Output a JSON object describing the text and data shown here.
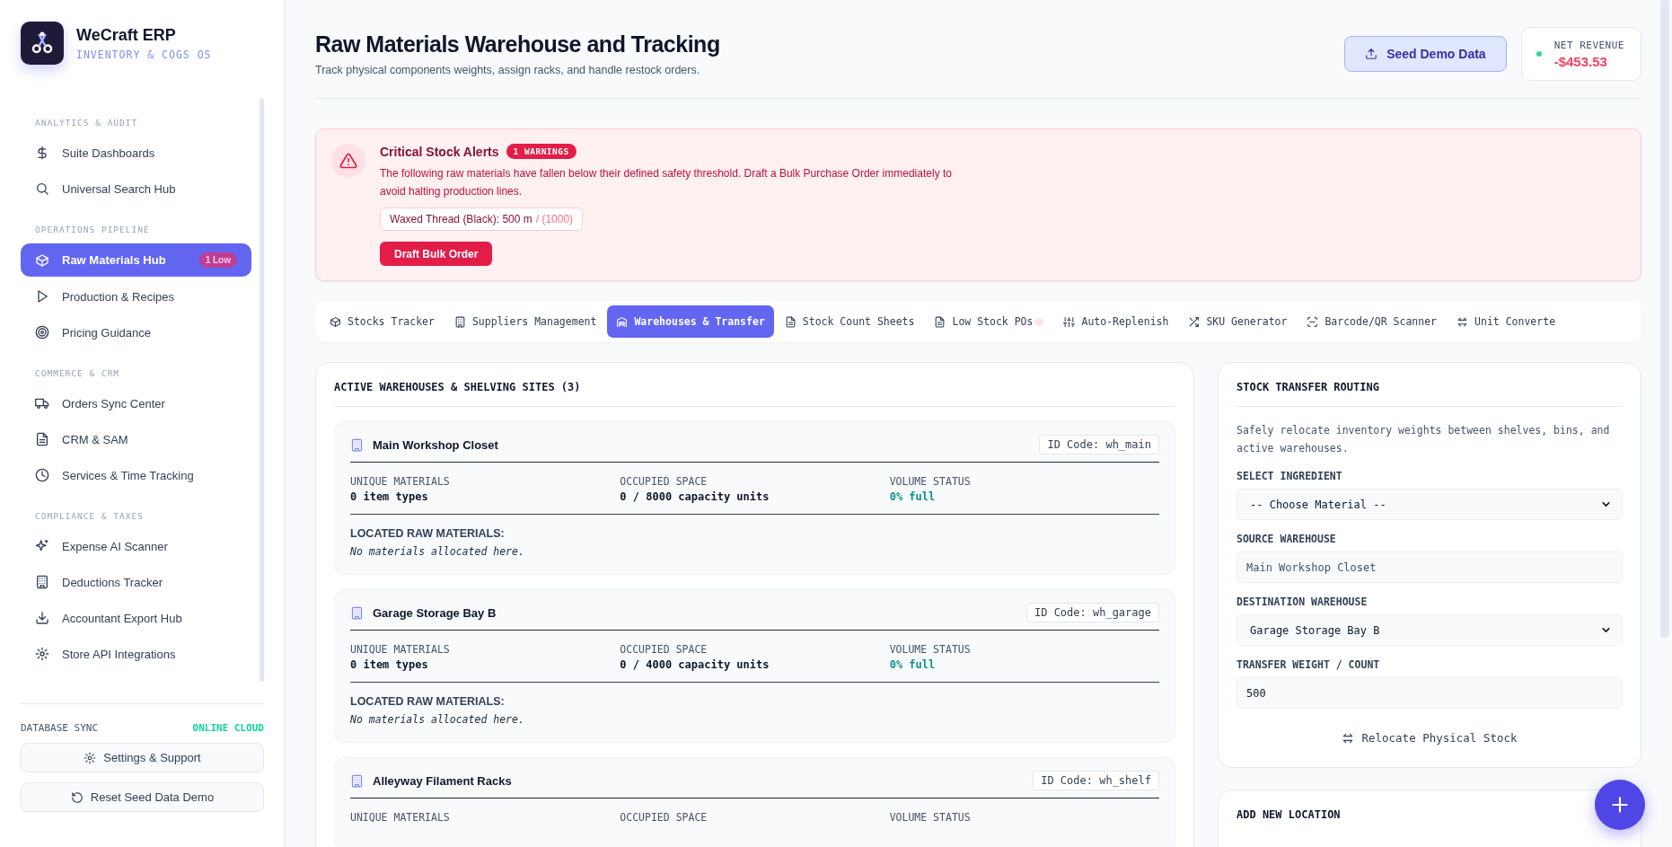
{
  "brand": {
    "name": "WeCraft ERP",
    "tagline": "INVENTORY & COGS OS"
  },
  "sidebar": {
    "sections": [
      {
        "heading": "ANALYTICS & AUDIT",
        "items": [
          {
            "label": "Suite Dashboards",
            "selected": false
          },
          {
            "label": "Universal Search Hub",
            "selected": false
          }
        ]
      },
      {
        "heading": "OPERATIONS PIPELINE",
        "items": [
          {
            "label": "Raw Materials Hub",
            "selected": true,
            "badge": "1 Low"
          },
          {
            "label": "Production & Recipes",
            "selected": false
          },
          {
            "label": "Pricing Guidance",
            "selected": false
          }
        ]
      },
      {
        "heading": "COMMERCE & CRM",
        "items": [
          {
            "label": "Orders Sync Center",
            "selected": false
          },
          {
            "label": "CRM & SAM",
            "selected": false
          },
          {
            "label": "Services & Time Tracking",
            "selected": false
          }
        ]
      },
      {
        "heading": "COMPLIANCE & TAXES",
        "items": [
          {
            "label": "Expense AI Scanner",
            "selected": false
          },
          {
            "label": "Deductions Tracker",
            "selected": false
          },
          {
            "label": "Accountant Export Hub",
            "selected": false
          },
          {
            "label": "Store API Integrations",
            "selected": false
          }
        ]
      }
    ]
  },
  "sidebar_footer": {
    "sync_label": "DATABASE SYNC",
    "sync_status": "ONLINE CLOUD",
    "buttons": [
      "Settings & Support",
      "Reset Seed Data Demo"
    ]
  },
  "header": {
    "title": "Raw Materials Warehouse and Tracking",
    "subtitle": "Track physical components weights, assign racks, and handle restock orders.",
    "seed_button": "Seed Demo Data",
    "net_revenue": {
      "label": "NET REVENUE",
      "value": "-$453.53"
    }
  },
  "alert": {
    "title": "Critical Stock Alerts",
    "badge": "1 WARNINGS",
    "message": "The following raw materials have fallen below their defined safety threshold. Draft a Bulk Purchase Order immediately to avoid halting production lines.",
    "items": [
      {
        "name": "Waxed Thread (Black): 500 m",
        "threshold": "/ (1000)"
      }
    ],
    "button": "Draft Bulk Order"
  },
  "tabs": [
    {
      "label": "Stocks Tracker",
      "selected": false
    },
    {
      "label": "Suppliers Management",
      "selected": false
    },
    {
      "label": "Warehouses & Transfer",
      "selected": true
    },
    {
      "label": "Stock Count Sheets",
      "selected": false
    },
    {
      "label": "Low Stock POs",
      "selected": false,
      "dot": true
    },
    {
      "label": "Auto-Replenish",
      "selected": false
    },
    {
      "label": "SKU Generator",
      "selected": false
    },
    {
      "label": "Barcode/QR Scanner",
      "selected": false
    },
    {
      "label": "Unit Converte",
      "selected": false
    }
  ],
  "warehouses": {
    "title": "ACTIVE WAREHOUSES & SHELVING SITES (3)",
    "sites": [
      {
        "name": "Main Workshop Closet",
        "id_code": "ID Code: wh_main",
        "stats": [
          {
            "label": "UNIQUE MATERIALS",
            "value": "0 item types"
          },
          {
            "label": "OCCUPIED SPACE",
            "value": "0 / 8000 capacity units"
          },
          {
            "label": "VOLUME STATUS",
            "value": "0% full",
            "kind": "status"
          }
        ],
        "materials_label": "LOCATED RAW MATERIALS:",
        "materials_empty": "No materials allocated here."
      },
      {
        "name": "Garage Storage Bay B",
        "id_code": "ID Code: wh_garage",
        "stats": [
          {
            "label": "UNIQUE MATERIALS",
            "value": "0 item types"
          },
          {
            "label": "OCCUPIED SPACE",
            "value": "0 / 4000 capacity units"
          },
          {
            "label": "VOLUME STATUS",
            "value": "0% full",
            "kind": "status"
          }
        ],
        "materials_label": "LOCATED RAW MATERIALS:",
        "materials_empty": "No materials allocated here."
      },
      {
        "name": "Alleyway Filament Racks",
        "id_code": "ID Code: wh_shelf",
        "stats": [
          {
            "label": "UNIQUE MATERIALS"
          },
          {
            "label": "OCCUPIED SPACE"
          },
          {
            "label": "VOLUME STATUS"
          }
        ]
      }
    ]
  },
  "transfer": {
    "title": "STOCK TRANSFER ROUTING",
    "description": "Safely relocate inventory weights between shelves, bins, and active warehouses.",
    "fields": [
      {
        "kind": "select",
        "label": "SELECT INGREDIENT",
        "value": "-- Choose Material --"
      },
      {
        "kind": "readonly",
        "label": "SOURCE WAREHOUSE",
        "value": "Main Workshop Closet"
      },
      {
        "kind": "select",
        "label": "DESTINATION WAREHOUSE",
        "value": "Garage Storage Bay B"
      },
      {
        "kind": "input",
        "label": "TRANSFER WEIGHT / COUNT",
        "value": "500"
      }
    ],
    "button": "Relocate Physical Stock"
  },
  "add_location": {
    "title": "ADD NEW LOCATION"
  }
}
